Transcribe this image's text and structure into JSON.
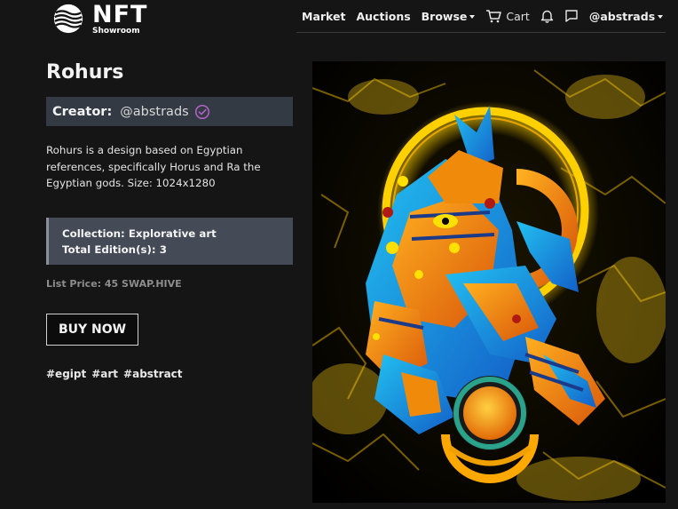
{
  "brand": {
    "name": "NFT",
    "subtitle": "Showroom"
  },
  "nav": {
    "market": "Market",
    "auctions": "Auctions",
    "browse": "Browse",
    "cart": "Cart",
    "user": "@abstrads"
  },
  "item": {
    "title": "Rohurs",
    "creator_label": "Creator:",
    "creator_handle": "@abstrads",
    "description": "Rohurs is a design based on Egyptian references, specifically Horus and Ra the Egyptian gods. Size: 1024x1280",
    "collection": "Collection: Explorative art",
    "editions": "Total Edition(s): 3",
    "price": "List Price: 45 SWAP.HIVE",
    "buy_label": "BUY NOW",
    "tags": [
      "#egipt",
      "#art",
      "#abstract"
    ]
  },
  "colors": {
    "background": "#151515",
    "creator_bar": "#343a44",
    "collection_box": "#444a56",
    "verified": "#b462c8",
    "art_gold": "#f2c200",
    "art_blue": "#1e8fe0",
    "art_orange": "#f08a0a"
  },
  "icons": [
    "nft-logo-icon",
    "cart-icon",
    "bell-icon",
    "chat-icon",
    "verified-icon"
  ]
}
